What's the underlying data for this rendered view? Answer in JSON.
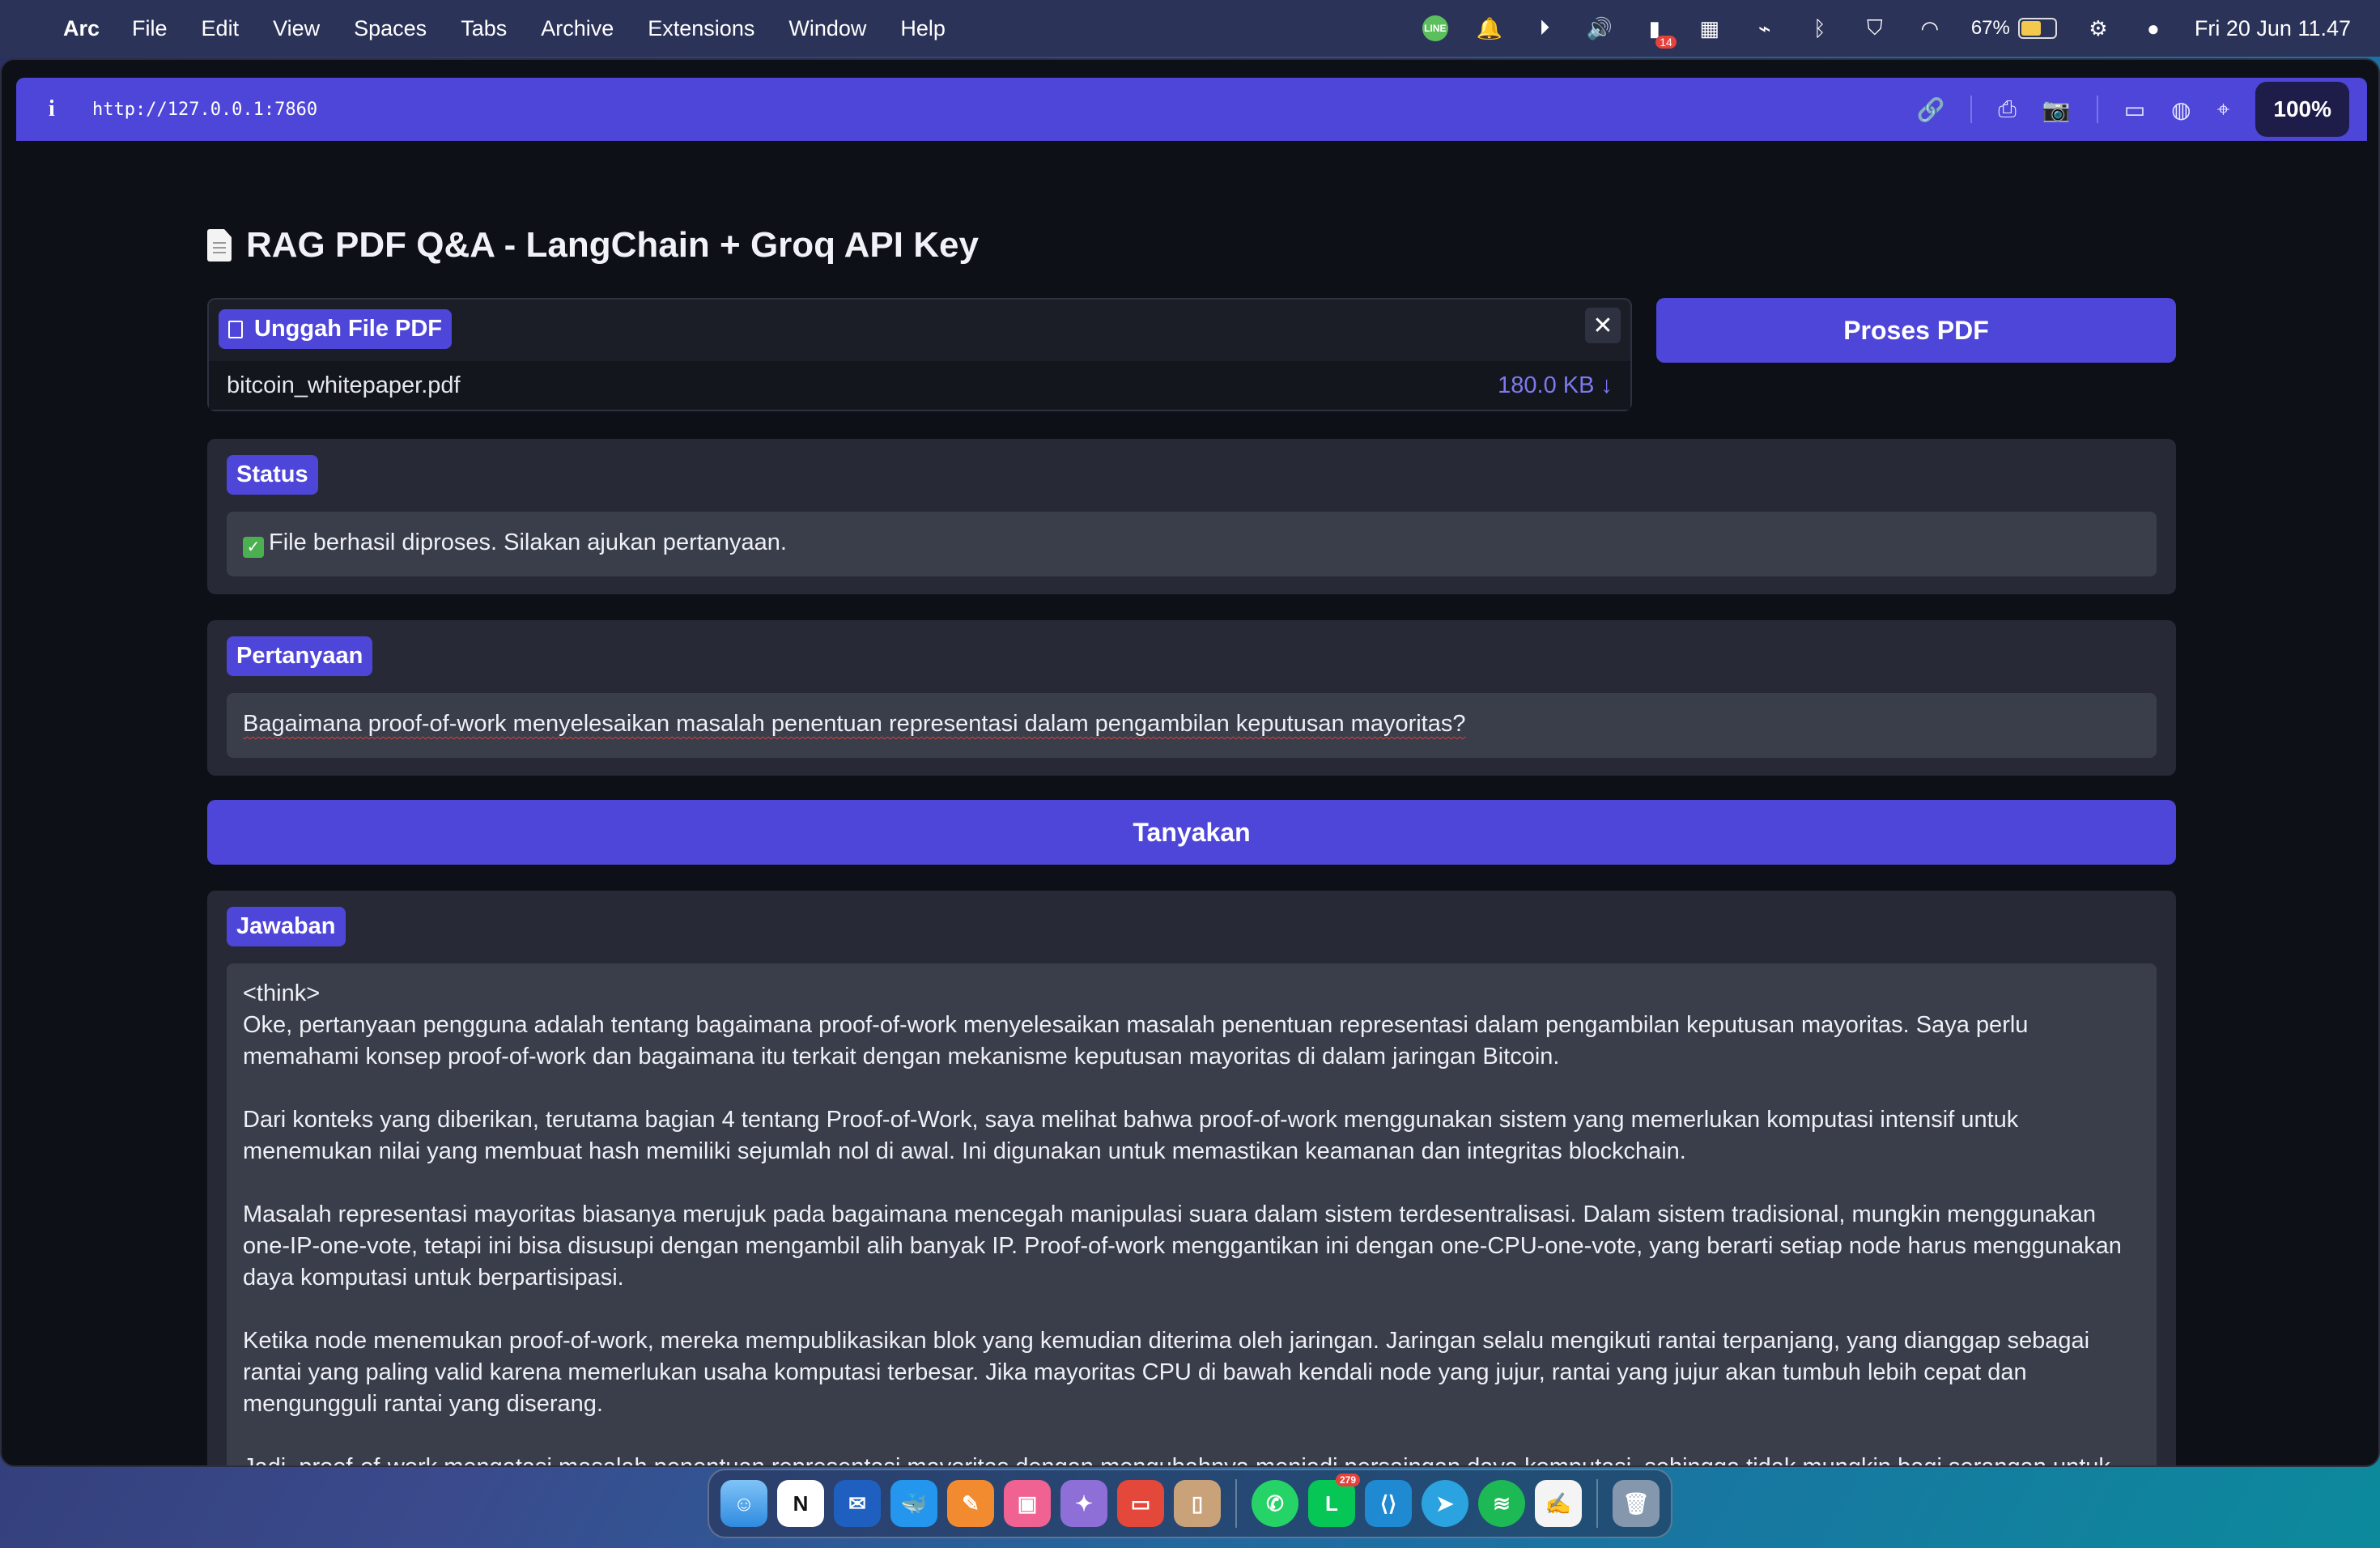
{
  "menubar": {
    "app_name": "Arc",
    "menus": [
      "File",
      "Edit",
      "View",
      "Spaces",
      "Tabs",
      "Archive",
      "Extensions",
      "Window",
      "Help"
    ],
    "line_label": "LINE",
    "notif_count": "14",
    "battery_percent": "67%",
    "battery_level": 0.67,
    "clock": "Fri 20 Jun  11.47"
  },
  "browser": {
    "url": "http://127.0.0.1:7860",
    "zoom": "100%",
    "accent_color": "#4e46d8"
  },
  "page": {
    "title": "RAG PDF Q&A - LangChain + Groq API Key",
    "upload": {
      "label": "Unggah File PDF",
      "file_name": "bitcoin_whitepaper.pdf",
      "file_size": "180.0 KB ↓"
    },
    "process_button": "Proses PDF",
    "status": {
      "label": "Status",
      "value": "File berhasil diproses. Silakan ajukan pertanyaan."
    },
    "question": {
      "label": "Pertanyaan",
      "value": "Bagaimana proof-of-work menyelesaikan masalah penentuan representasi dalam pengambilan keputusan mayoritas?"
    },
    "ask_button": "Tanyakan",
    "answer": {
      "label": "Jawaban",
      "paragraphs": [
        "<think>\nOke, pertanyaan pengguna adalah tentang bagaimana proof-of-work menyelesaikan masalah penentuan representasi dalam pengambilan keputusan mayoritas. Saya perlu memahami konsep proof-of-work dan bagaimana itu terkait dengan mekanisme keputusan mayoritas di dalam jaringan Bitcoin.",
        "Dari konteks yang diberikan, terutama bagian 4 tentang Proof-of-Work, saya melihat bahwa proof-of-work menggunakan sistem yang memerlukan komputasi intensif untuk menemukan nilai yang membuat hash memiliki sejumlah nol di awal. Ini digunakan untuk memastikan keamanan dan integritas blockchain.",
        "Masalah representasi mayoritas biasanya merujuk pada bagaimana mencegah manipulasi suara dalam sistem terdesentralisasi. Dalam sistem tradisional, mungkin menggunakan one-IP-one-vote, tetapi ini bisa disusupi dengan mengambil alih banyak IP. Proof-of-work menggantikan ini dengan one-CPU-one-vote, yang berarti setiap node harus menggunakan daya komputasi untuk berpartisipasi.",
        "Ketika node menemukan proof-of-work, mereka mempublikasikan blok yang kemudian diterima oleh jaringan. Jaringan selalu mengikuti rantai terpanjang, yang dianggap sebagai rantai yang paling valid karena memerlukan usaha komputasi terbesar. Jika mayoritas CPU di bawah kendali node yang jujur, rantai yang jujur akan tumbuh lebih cepat dan mengungguli rantai yang diserang.",
        "Jadi, proof-of-work mengatasi masalah penentuan representasi mayoritas dengan mengubahnya menjadi persaingan daya komputasi, sehingga tidak mungkin bagi serangan untuk menguasai jaringan tanpa kontrol lebih dari setengah dari total daya komputasi. Ini memastikan bahwa keputusan mayoritas didasarkan"
      ]
    }
  },
  "dock": {
    "apps": [
      "finder-icon",
      "notion-icon",
      "mail-icon",
      "docker-icon",
      "vector-app-icon",
      "photos-icon",
      "app-icon",
      "slides-icon",
      "books-icon",
      "whatsapp-icon",
      "line-icon",
      "vscode-icon",
      "telegram-icon",
      "spotify-icon",
      "textedit-icon",
      "trash-icon"
    ],
    "line_badge": "279"
  }
}
